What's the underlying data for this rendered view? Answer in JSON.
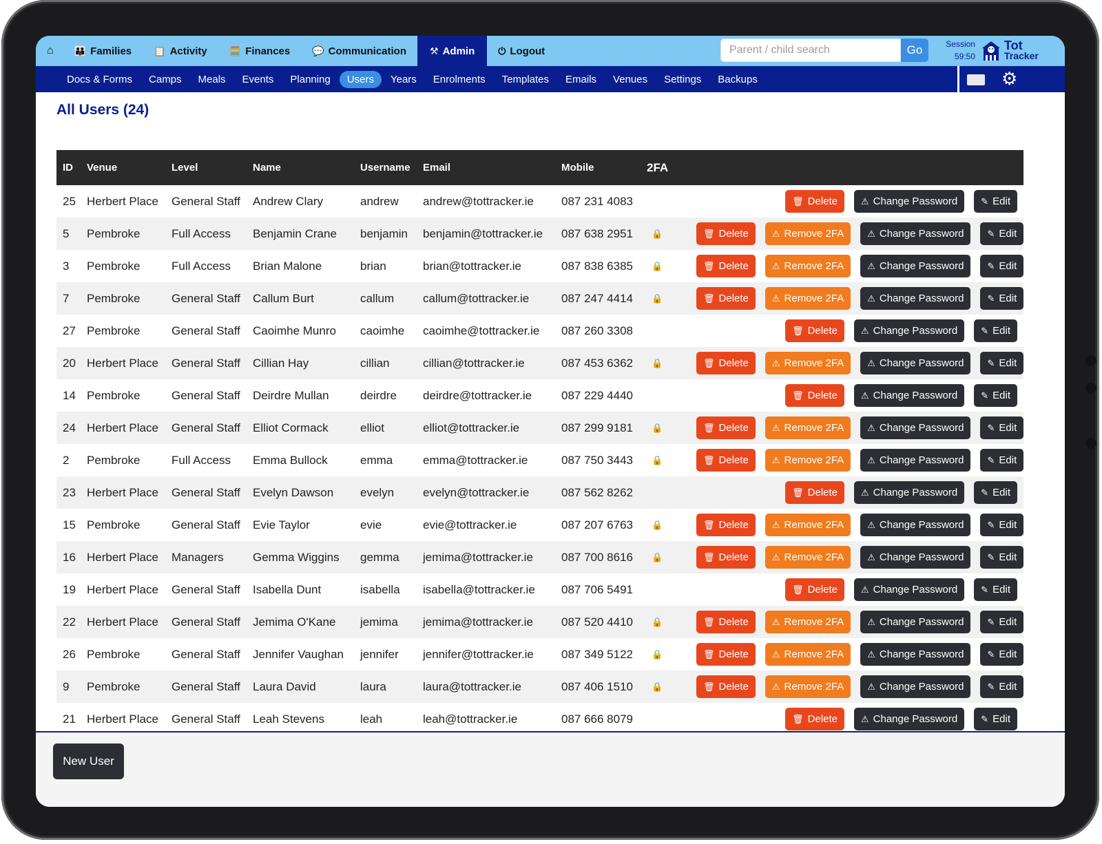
{
  "nav": {
    "home_icon": "home-icon",
    "items": [
      {
        "label": "Families",
        "icon": "people-icon",
        "glyph": "👪"
      },
      {
        "label": "Activity",
        "icon": "clipboard-icon",
        "glyph": "📋"
      },
      {
        "label": "Finances",
        "icon": "calculator-icon",
        "glyph": "🧮"
      },
      {
        "label": "Communication",
        "icon": "chat-icon",
        "glyph": "💬"
      },
      {
        "label": "Admin",
        "icon": "tools-icon",
        "glyph": "⚒"
      },
      {
        "label": "Logout",
        "icon": "power-icon",
        "glyph": "⏻"
      }
    ],
    "active": "Admin"
  },
  "search": {
    "placeholder": "Parent / child search",
    "value": "",
    "go_label": "Go"
  },
  "session": {
    "label": "Session",
    "time": "59:50"
  },
  "logo": {
    "line1": "Tot",
    "line2": "Tracker"
  },
  "subnav": {
    "items": [
      "Docs & Forms",
      "Camps",
      "Meals",
      "Events",
      "Planning",
      "Users",
      "Years",
      "Enrolments",
      "Templates",
      "Emails",
      "Venues",
      "Settings",
      "Backups"
    ],
    "active": "Users",
    "mail_icon": "mail-icon",
    "settings_icon": "gear-icon"
  },
  "page": {
    "title": "All Users (24)"
  },
  "table": {
    "columns": [
      "ID",
      "Venue",
      "Level",
      "Name",
      "Username",
      "Email",
      "Mobile",
      "2FA"
    ],
    "actions": {
      "delete": "Delete",
      "remove2fa": "Remove 2FA",
      "change_password": "Change Password",
      "edit": "Edit"
    },
    "rows": [
      {
        "id": "25",
        "venue": "Herbert Place",
        "level": "General Staff",
        "name": "Andrew Clary",
        "username": "andrew",
        "email": "andrew@tottracker.ie",
        "mobile": "087 231 4083",
        "twofa": false
      },
      {
        "id": "5",
        "venue": "Pembroke",
        "level": "Full Access",
        "name": "Benjamin Crane",
        "username": "benjamin",
        "email": "benjamin@tottracker.ie",
        "mobile": "087 638 2951",
        "twofa": true
      },
      {
        "id": "3",
        "venue": "Pembroke",
        "level": "Full Access",
        "name": "Brian Malone",
        "username": "brian",
        "email": "brian@tottracker.ie",
        "mobile": "087 838 6385",
        "twofa": true
      },
      {
        "id": "7",
        "venue": "Pembroke",
        "level": "General Staff",
        "name": "Callum Burt",
        "username": "callum",
        "email": "callum@tottracker.ie",
        "mobile": "087 247 4414",
        "twofa": true
      },
      {
        "id": "27",
        "venue": "Pembroke",
        "level": "General Staff",
        "name": "Caoimhe Munro",
        "username": "caoimhe",
        "email": "caoimhe@tottracker.ie",
        "mobile": "087 260 3308",
        "twofa": false
      },
      {
        "id": "20",
        "venue": "Herbert Place",
        "level": "General Staff",
        "name": "Cillian Hay",
        "username": "cillian",
        "email": "cillian@tottracker.ie",
        "mobile": "087 453 6362",
        "twofa": true
      },
      {
        "id": "14",
        "venue": "Pembroke",
        "level": "General Staff",
        "name": "Deirdre Mullan",
        "username": "deirdre",
        "email": "deirdre@tottracker.ie",
        "mobile": "087 229 4440",
        "twofa": false
      },
      {
        "id": "24",
        "venue": "Herbert Place",
        "level": "General Staff",
        "name": "Elliot Cormack",
        "username": "elliot",
        "email": "elliot@tottracker.ie",
        "mobile": "087 299 9181",
        "twofa": true
      },
      {
        "id": "2",
        "venue": "Pembroke",
        "level": "Full Access",
        "name": "Emma Bullock",
        "username": "emma",
        "email": "emma@tottracker.ie",
        "mobile": "087 750 3443",
        "twofa": true
      },
      {
        "id": "23",
        "venue": "Herbert Place",
        "level": "General Staff",
        "name": "Evelyn Dawson",
        "username": "evelyn",
        "email": "evelyn@tottracker.ie",
        "mobile": "087 562 8262",
        "twofa": false
      },
      {
        "id": "15",
        "venue": "Pembroke",
        "level": "General Staff",
        "name": "Evie Taylor",
        "username": "evie",
        "email": "evie@tottracker.ie",
        "mobile": "087 207 6763",
        "twofa": true
      },
      {
        "id": "16",
        "venue": "Herbert Place",
        "level": "Managers",
        "name": "Gemma Wiggins",
        "username": "gemma",
        "email": "jemima@tottracker.ie",
        "mobile": "087 700 8616",
        "twofa": true
      },
      {
        "id": "19",
        "venue": "Herbert Place",
        "level": "General Staff",
        "name": "Isabella Dunt",
        "username": "isabella",
        "email": "isabella@tottracker.ie",
        "mobile": "087 706 5491",
        "twofa": false
      },
      {
        "id": "22",
        "venue": "Herbert Place",
        "level": "General Staff",
        "name": "Jemima O'Kane",
        "username": "jemima",
        "email": "jemima@tottracker.ie",
        "mobile": "087 520 4410",
        "twofa": true
      },
      {
        "id": "26",
        "venue": "Pembroke",
        "level": "General Staff",
        "name": "Jennifer Vaughan",
        "username": "jennifer",
        "email": "jennifer@tottracker.ie",
        "mobile": "087 349 5122",
        "twofa": true
      },
      {
        "id": "9",
        "venue": "Pembroke",
        "level": "General Staff",
        "name": "Laura David",
        "username": "laura",
        "email": "laura@tottracker.ie",
        "mobile": "087 406 1510",
        "twofa": true
      },
      {
        "id": "21",
        "venue": "Herbert Place",
        "level": "General Staff",
        "name": "Leah Stevens",
        "username": "leah",
        "email": "leah@tottracker.ie",
        "mobile": "087 666 8079",
        "twofa": false
      }
    ]
  },
  "footer": {
    "new_user_label": "New User"
  },
  "colors": {
    "nav_bg": "#7ec8f3",
    "brand": "#0a1f8f",
    "accent": "#3b8fe3",
    "delete": "#e8471e",
    "remove2fa": "#f07c1f",
    "dark_button": "#2c2e33"
  }
}
